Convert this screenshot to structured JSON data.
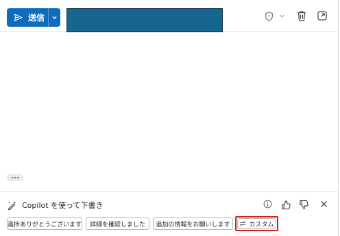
{
  "toolbar": {
    "send_label": "送信",
    "icons": [
      "send-icon",
      "chevron-down-icon",
      "sensitivity-icon",
      "chevron-down-icon",
      "trash-icon",
      "popout-icon"
    ]
  },
  "copilot": {
    "title": "Copilot を使って下書き",
    "chips": [
      "進捗ありがとうございます",
      "詳細を確認しました",
      "追加の情報をお願いします"
    ],
    "custom_label": "カスタム",
    "icons": [
      "copilot-pen-icon",
      "info-icon",
      "thumbs-up-icon",
      "thumbs-down-icon",
      "close-icon",
      "swap-icon"
    ]
  },
  "colors": {
    "accent": "#0f6cbd",
    "redacted": "#17668f",
    "highlight_outline": "#d91a1a"
  }
}
